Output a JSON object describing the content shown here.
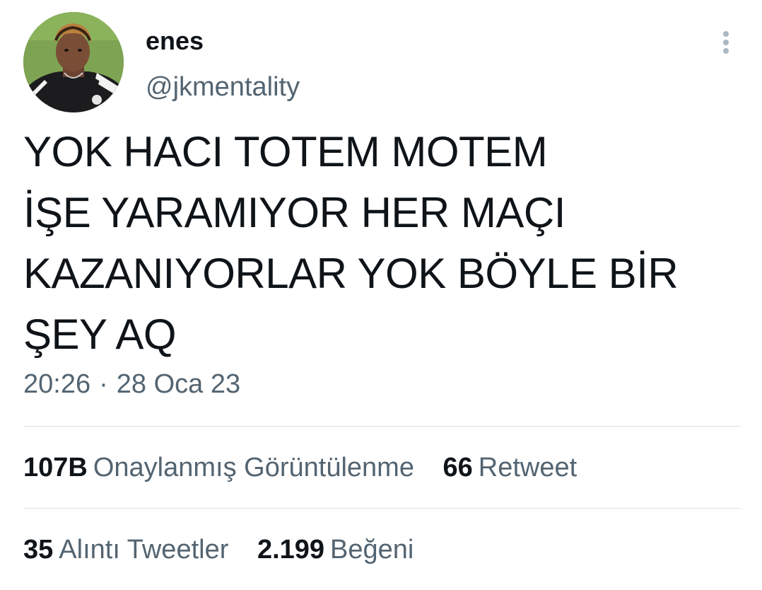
{
  "tweet": {
    "author": {
      "display_name": "enes",
      "handle": "@jkmentality"
    },
    "text_lines": [
      "YOK HACI TOTEM MOTEM",
      "İŞE YARAMIYOR HER MAÇI",
      "KAZANIYORLAR YOK BÖYLE BİR",
      "ŞEY AQ"
    ],
    "time": "20:26",
    "separator": "·",
    "date": "28 Oca 23",
    "stats_row1": [
      {
        "count": "107B",
        "label": "Onaylanmış Görüntülenme"
      },
      {
        "count": "66",
        "label": "Retweet"
      }
    ],
    "stats_row2": [
      {
        "count": "35",
        "label": "Alıntı Tweetler"
      },
      {
        "count": "2.199",
        "label": "Beğeni"
      }
    ]
  },
  "icons": {
    "more_menu": "more-vertical-icon",
    "avatar": "user-avatar-photo"
  },
  "colors": {
    "text_primary": "#0f1419",
    "text_secondary": "#536471",
    "divider": "#dbe1e6",
    "more_dots": "#aab8c2"
  }
}
